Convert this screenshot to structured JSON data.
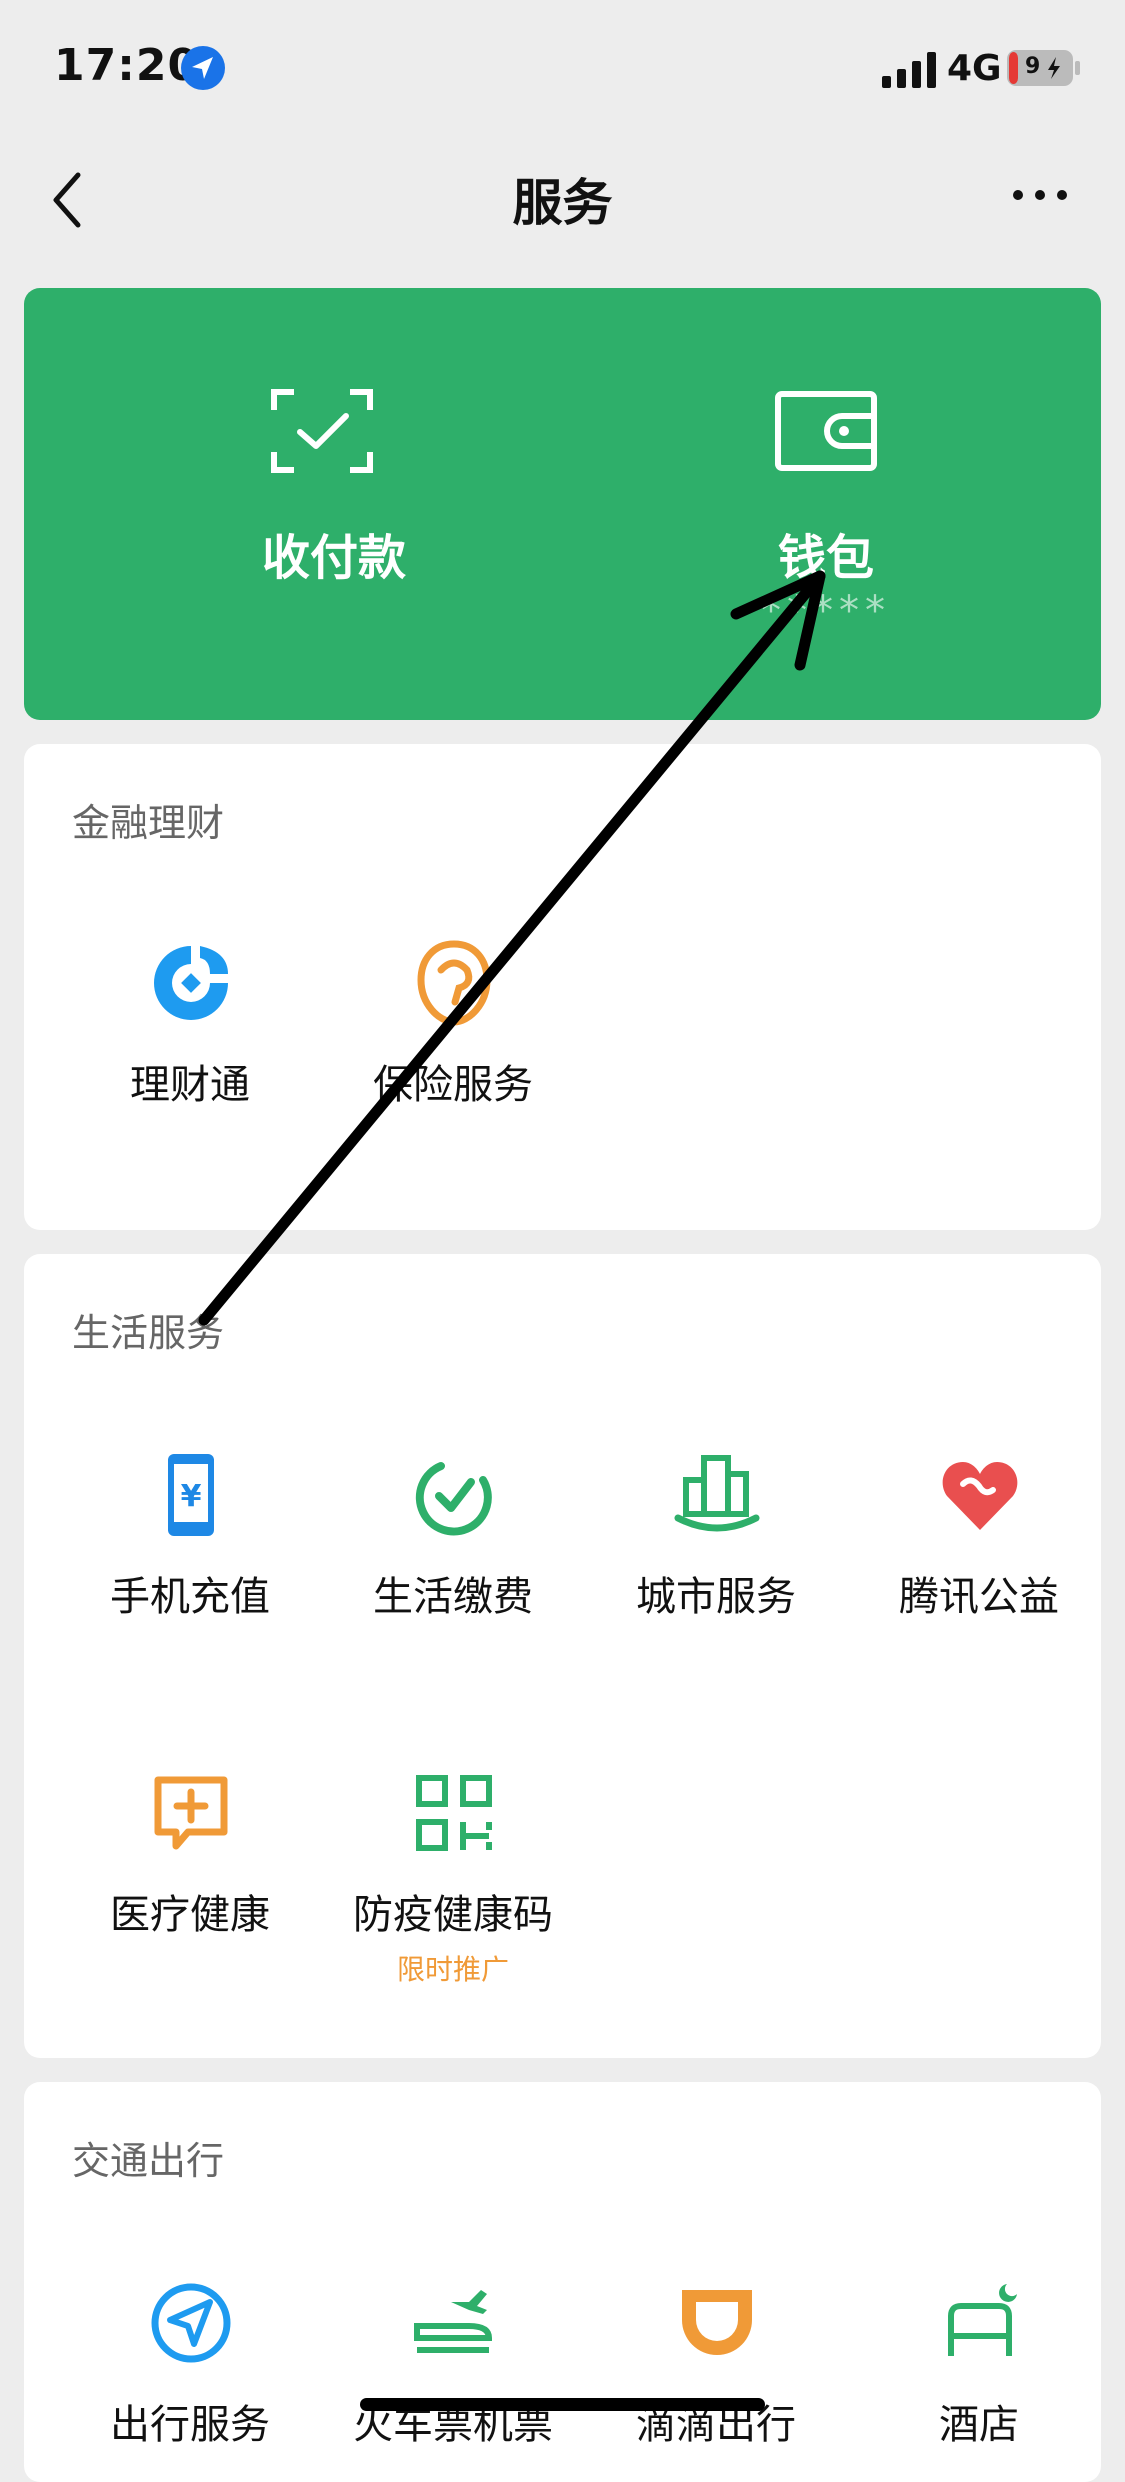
{
  "status_bar": {
    "time": "17:20",
    "network": "4G",
    "battery": "9"
  },
  "nav": {
    "title": "服务",
    "back_icon": "chevron-left-icon",
    "more_icon": "more-icon"
  },
  "hero": {
    "pay": {
      "label": "收付款",
      "icon": "scan-check-icon"
    },
    "wallet": {
      "label": "钱包",
      "balance": "*****",
      "icon": "wallet-icon"
    }
  },
  "sections": {
    "finance": {
      "title": "金融理财",
      "items": [
        {
          "label": "理财通",
          "icon": "licaitong-icon",
          "color": "#1e9bf0"
        },
        {
          "label": "保险服务",
          "icon": "insurance-icon",
          "color": "#f09a37"
        }
      ]
    },
    "life": {
      "title": "生活服务",
      "items": [
        {
          "label": "手机充值",
          "icon": "phone-recharge-icon",
          "color": "#1e88e5"
        },
        {
          "label": "生活缴费",
          "icon": "bill-payment-icon",
          "color": "#2eaf6a"
        },
        {
          "label": "城市服务",
          "icon": "city-service-icon",
          "color": "#2eaf6a"
        },
        {
          "label": "腾讯公益",
          "icon": "charity-heart-icon",
          "color": "#e94f4f"
        },
        {
          "label": "医疗健康",
          "icon": "medical-icon",
          "color": "#f09a37"
        },
        {
          "label": "防疫健康码",
          "icon": "qr-code-icon",
          "color": "#2eaf6a",
          "sub": "限时推广"
        }
      ]
    },
    "transport": {
      "title": "交通出行",
      "items": [
        {
          "label": "出行服务",
          "icon": "navigation-icon",
          "color": "#1e9bf0"
        },
        {
          "label": "火车票机票",
          "icon": "train-plane-icon",
          "color": "#2eaf6a"
        },
        {
          "label": "滴滴出行",
          "icon": "didi-icon",
          "color": "#f09a37"
        },
        {
          "label": "酒店",
          "icon": "hotel-icon",
          "color": "#2eaf6a"
        }
      ]
    }
  },
  "colors": {
    "green": "#2eaf6a",
    "background": "#ededed",
    "promo": "#f09a37"
  }
}
